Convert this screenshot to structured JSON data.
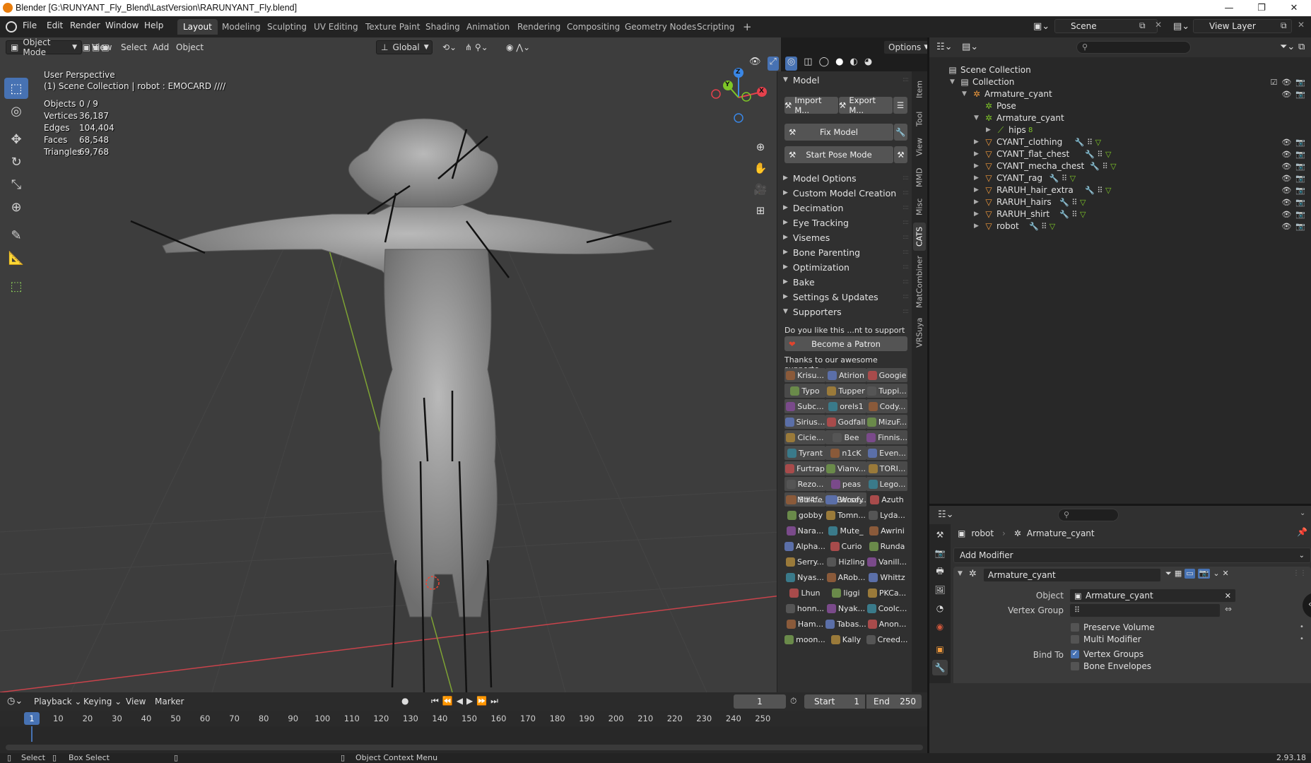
{
  "window": {
    "title": "Blender [G:\\RUNYANT_Fly_Blend\\LastVersion\\RARUNYANT_Fly.blend]",
    "controls": [
      "—",
      "❐",
      "✕"
    ]
  },
  "menubar": {
    "menus": [
      "File",
      "Edit",
      "Render",
      "Window",
      "Help"
    ],
    "workspace_tabs": [
      {
        "label": "Layout",
        "active": true
      },
      {
        "label": "Modeling"
      },
      {
        "label": "Sculpting"
      },
      {
        "label": "UV Editing"
      },
      {
        "label": "Texture Paint"
      },
      {
        "label": "Shading"
      },
      {
        "label": "Animation"
      },
      {
        "label": "Rendering"
      },
      {
        "label": "Compositing"
      },
      {
        "label": "Geometry Nodes"
      },
      {
        "label": "Scripting"
      }
    ],
    "add_tab": "+",
    "scene": "Scene",
    "view_layer": "View Layer"
  },
  "viewport_header": {
    "mode": "Object Mode",
    "menus": [
      "View",
      "Select",
      "Add",
      "Object"
    ],
    "transform_orientation": "Global",
    "options": "Options"
  },
  "viewport": {
    "view_name": "User Perspective",
    "collection_info": "(1) Scene Collection | robot : EMOCARD ////",
    "stats": [
      {
        "label": "Objects",
        "value": "0 / 9"
      },
      {
        "label": "Vertices",
        "value": "36,187"
      },
      {
        "label": "Edges",
        "value": "104,404"
      },
      {
        "label": "Faces",
        "value": "68,548"
      },
      {
        "label": "Triangles",
        "value": "69,768"
      }
    ],
    "gizmo_axes": {
      "z": "Z",
      "y": "Y",
      "x": "X"
    },
    "axis_colors": {
      "x": "#e5414c",
      "y": "#7ec627",
      "z": "#3a87e6"
    }
  },
  "npanel": {
    "section_model": "Model",
    "import_label": "Import M...",
    "export_label": "Export M...",
    "fix_model": "Fix Model",
    "start_pose": "Start Pose Mode",
    "sections": [
      "Model Options",
      "Custom Model Creation",
      "Decimation",
      "Eye Tracking",
      "Visemes",
      "Bone Parenting",
      "Optimization",
      "Bake",
      "Settings & Updates"
    ],
    "supporters_header": "Supporters",
    "support_question": "Do you like this ...nt to support us?",
    "patron_button": "Become a Patron",
    "thanks_text": "Thanks to our awesome supporte...",
    "supporters_boxed": [
      "Krisu...",
      "Atirion",
      "Googie",
      "Typo",
      "Tupper",
      "Tuppi...",
      "Subc...",
      "orels1",
      "Cody...",
      "Sirius...",
      "Godfall",
      "MizuF...",
      "Cicie...",
      "Bee",
      "Finnis...",
      "Tyrant",
      "n1cK",
      "Even...",
      "Furtrap",
      "Vianv...",
      "TORI...",
      "Rezo...",
      "peas",
      "Lego...",
      "Millic...",
      "Woofy"
    ],
    "supporters_plain": [
      "Str4fe",
      "Berse...",
      "Azuth",
      "gobby",
      "Tomn...",
      "Lyda...",
      "Nara...",
      "Mute_",
      "Awrini",
      "Alpha...",
      "Curio",
      "Runda",
      "Serry...",
      "Hizling",
      "Vanill...",
      "Nyas...",
      "ARob...",
      "Whittz",
      "Lhun",
      "liggi",
      "PKCa...",
      "honn...",
      "Nyak...",
      "Coolc...",
      "Ham...",
      "Tabas...",
      "Anon...",
      "moon...",
      "Kally",
      "Creed..."
    ],
    "tabs": [
      "Item",
      "Tool",
      "View",
      "MMD",
      "Misc",
      "CATS",
      "MatCombiner",
      "VRSuya"
    ],
    "active_tab": "CATS"
  },
  "outliner": {
    "rows": [
      {
        "label": "Scene Collection",
        "depth": 0,
        "icon": "scene-collection-icon",
        "expander": ""
      },
      {
        "label": "Collection",
        "depth": 1,
        "icon": "collection-icon",
        "expander": "▼",
        "checkbox": true
      },
      {
        "label": "Armature_cyant",
        "depth": 2,
        "icon": "armature-object-icon",
        "expander": "▼",
        "vis": true
      },
      {
        "label": "Pose",
        "depth": 3,
        "icon": "pose-icon",
        "expander": ""
      },
      {
        "label": "Armature_cyant",
        "depth": 3,
        "icon": "armature-data-icon",
        "expander": "▼"
      },
      {
        "label": "hips",
        "depth": 4,
        "icon": "bone-icon",
        "expander": "▶",
        "suffix": "8"
      },
      {
        "label": "CYANT_clothing",
        "depth": 3,
        "icon": "mesh-icon",
        "expander": "▶",
        "vis": true,
        "mods": true
      },
      {
        "label": "CYANT_flat_chest",
        "depth": 3,
        "icon": "mesh-icon",
        "expander": "▶",
        "vis": true,
        "mods": true
      },
      {
        "label": "CYANT_mecha_chest",
        "depth": 3,
        "icon": "mesh-icon",
        "expander": "▶",
        "vis": true,
        "mods": true
      },
      {
        "label": "CYANT_rag",
        "depth": 3,
        "icon": "mesh-icon",
        "expander": "▶",
        "vis": true,
        "mods": true
      },
      {
        "label": "RARUH_hair_extra",
        "depth": 3,
        "icon": "mesh-icon",
        "expander": "▶",
        "vis": true,
        "mods": true
      },
      {
        "label": "RARUH_hairs",
        "depth": 3,
        "icon": "mesh-icon",
        "expander": "▶",
        "vis": true,
        "mods": true
      },
      {
        "label": "RARUH_shirt",
        "depth": 3,
        "icon": "mesh-icon",
        "expander": "▶",
        "vis": true,
        "mods": true
      },
      {
        "label": "robot",
        "depth": 3,
        "icon": "mesh-icon",
        "expander": "▶",
        "vis": true,
        "mods": true,
        "active": true
      }
    ]
  },
  "properties": {
    "breadcrumb_object": "robot",
    "breadcrumb_modifier": "Armature_cyant",
    "add_modifier": "Add Modifier",
    "modifier_name": "Armature_cyant",
    "object_label": "Object",
    "object_value": "Armature_cyant",
    "vertex_group_label": "Vertex Group",
    "preserve_volume": "Preserve Volume",
    "multi_modifier": "Multi Modifier",
    "bind_to_label": "Bind To",
    "vertex_groups": "Vertex Groups",
    "bone_envelopes": "Bone Envelopes",
    "vertex_groups_checked": true
  },
  "timeline": {
    "menus": [
      "Playback",
      "Keying",
      "View",
      "Marker"
    ],
    "current_frame": "1",
    "start_label": "Start",
    "start_value": "1",
    "end_label": "End",
    "end_value": "250",
    "ruler": [
      "1",
      "10",
      "20",
      "30",
      "40",
      "50",
      "60",
      "70",
      "80",
      "90",
      "100",
      "110",
      "120",
      "130",
      "140",
      "150",
      "160",
      "170",
      "180",
      "190",
      "200",
      "210",
      "220",
      "230",
      "240",
      "250"
    ],
    "playhead_label": "1"
  },
  "statusbar": {
    "select": "Select",
    "box_select": "Box Select",
    "context_menu": "Object Context Menu",
    "version": "2.93.18"
  }
}
